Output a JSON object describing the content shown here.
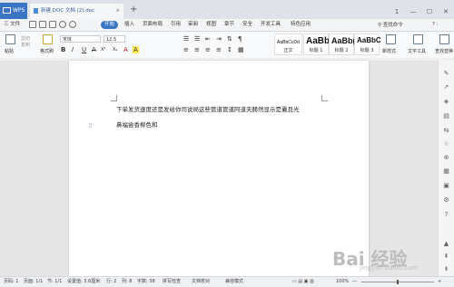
{
  "titlebar": {
    "app_name": "WPS",
    "doc_tab_label": "新建 DOC 文档 (2).doc",
    "new_tab_symbol": "+",
    "window_controls": [
      "1",
      "—",
      "☐",
      "✕"
    ]
  },
  "menu": {
    "file_label": "三 文件",
    "items": [
      "开始",
      "插入",
      "页面布局",
      "引用",
      "审阅",
      "视图",
      "章节",
      "安全",
      "开发工具",
      "特色应用"
    ],
    "active_item": "开始",
    "search_label": "查找命令",
    "help_label": "? :"
  },
  "ribbon": {
    "paste_label": "粘贴",
    "cut_label": "剪切",
    "copy_label": "复制",
    "format_painter_label": "格式刷",
    "font_name": "宋体",
    "font_size": "12.5",
    "format_buttons": [
      "B",
      "I",
      "U",
      "A",
      "X²",
      "X₂",
      "A",
      "A"
    ],
    "styles": [
      {
        "sample": "AaBbCcDd",
        "name": "正文"
      },
      {
        "sample": "AaBb",
        "name": "标题 1"
      },
      {
        "sample": "AaBb(",
        "name": "标题 2"
      },
      {
        "sample": "AaBbC",
        "name": "标题 3"
      }
    ],
    "new_style_label": "新样式",
    "text_tools_label": "文字工具",
    "find_replace_label": "查找替换"
  },
  "document": {
    "line1": "下单发货速度还是发给你司说局这些管道管道阿道夫赫然显示是囊且光",
    "line2": "鼻福尝香柳色和"
  },
  "statusbar": {
    "page_num": "页码: 1",
    "page_of": "页面: 1/1",
    "section": "节: 1/1",
    "setting": "设置值: 3.6厘米",
    "row": "行: 2",
    "col": "列: 8",
    "chars": "字数: 38",
    "spell_check": "拼写检查",
    "proofread": "文档校对",
    "compat_mode": "兼容模式",
    "zoom": "100%",
    "zoom_minus": "—",
    "zoom_plus": "+"
  },
  "watermark": {
    "logo_text": "Bai 经验",
    "url": "jingyan.baidu.com"
  }
}
